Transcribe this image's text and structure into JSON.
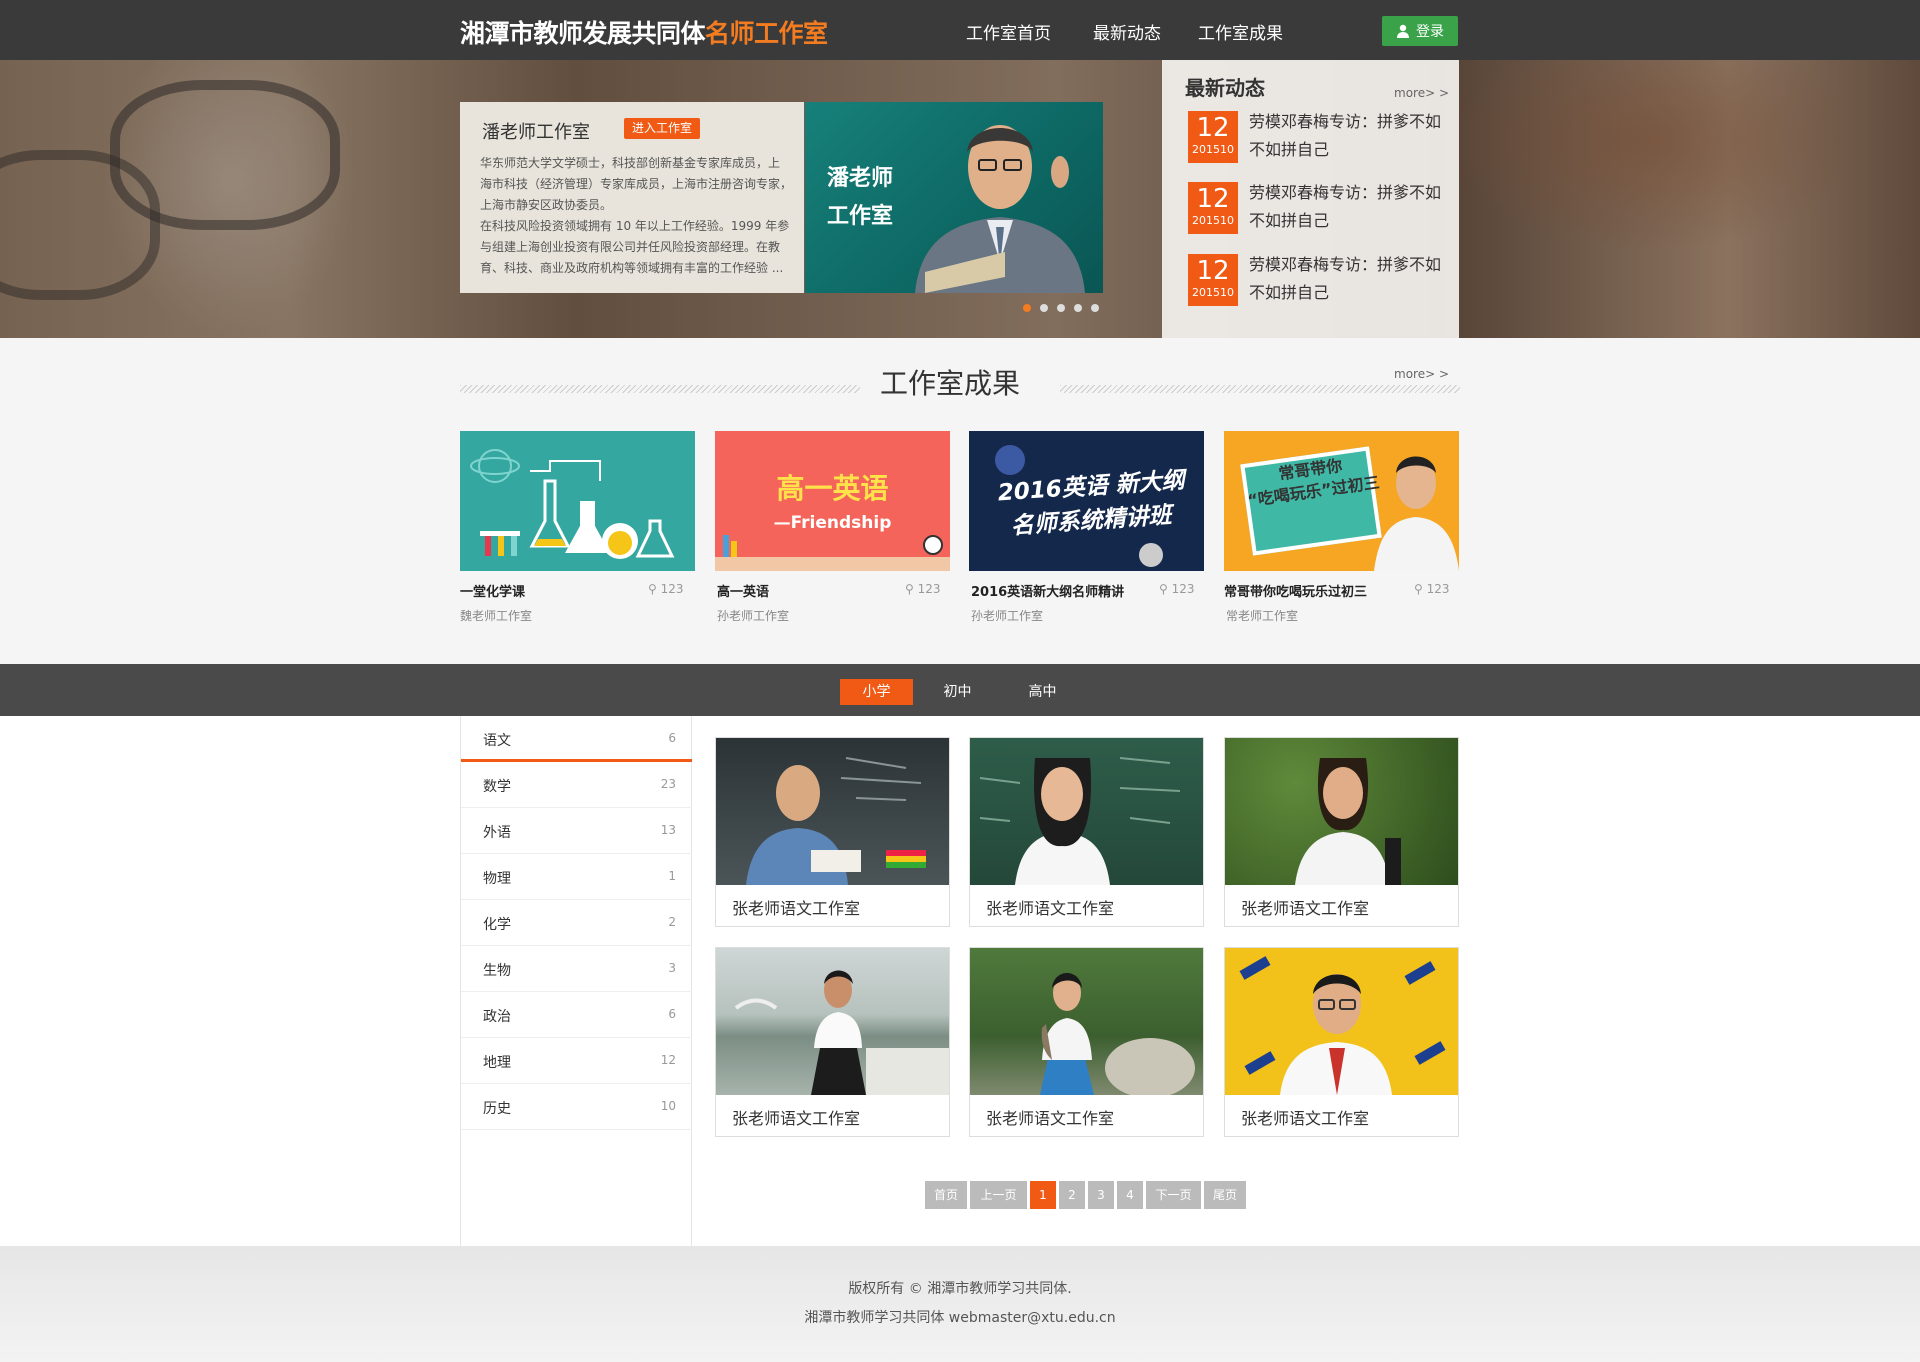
{
  "header": {
    "title_main": "湘潭市教师发展共同体",
    "title_highlight": "名师工作室",
    "nav": [
      "工作室首页",
      "最新动态",
      "工作室成果"
    ],
    "login_label": "登录"
  },
  "featured": {
    "name": "潘老师工作室",
    "badge": "进入工作室",
    "bio": [
      "华东师范大学文学硕士，科技部创新基金专家库成员，上",
      "海市科技（经济管理）专家库成员，上海市注册咨询专家，",
      "上海市静安区政协委员。",
      "在科技风险投资领域拥有 10 年以上工作经验。1999 年参",
      "与组建上海创业投资有限公司并任风险投资部经理。在教",
      "育、科技、商业及政府机构等领域拥有丰富的工作经验 ..."
    ],
    "photo_title_1": "潘老师",
    "photo_title_2": "工作室",
    "carousel_total": 5,
    "carousel_active": 1
  },
  "news": {
    "title": "最新动态",
    "more": "more> >",
    "items": [
      {
        "day": "12",
        "month": "201510",
        "text": "劳模邓春梅专访：拼爹不如不如拼自己"
      },
      {
        "day": "12",
        "month": "201510",
        "text": "劳模邓春梅专访：拼爹不如不如拼自己"
      },
      {
        "day": "12",
        "month": "201510",
        "text": "劳模邓春梅专访：拼爹不如不如拼自己"
      }
    ]
  },
  "achievements": {
    "title": "工作室成果",
    "more": "more> >",
    "cards": [
      {
        "title": "一堂化学课",
        "studio": "魏老师工作室",
        "count": "123",
        "banner": ""
      },
      {
        "title": "高一英语",
        "studio": "孙老师工作室",
        "count": "123",
        "banner": "高一英语",
        "banner_sub": "—Friendship"
      },
      {
        "title": "2016英语新大纲名师精讲",
        "studio": "孙老师工作室",
        "count": "123",
        "banner": "2016英语  新大纲",
        "banner_sub": "名师系统精讲班"
      },
      {
        "title": "常哥带你吃喝玩乐过初三",
        "studio": "常老师工作室",
        "count": "123",
        "banner": "常哥带你",
        "banner_sub": "“吃喝玩乐”过初三"
      }
    ]
  },
  "levels": {
    "tabs": [
      "小学",
      "初中",
      "高中"
    ],
    "active": 0
  },
  "subjects": [
    {
      "label": "语文",
      "count": "6"
    },
    {
      "label": "数学",
      "count": "23"
    },
    {
      "label": "外语",
      "count": "13"
    },
    {
      "label": "物理",
      "count": "1"
    },
    {
      "label": "化学",
      "count": "2"
    },
    {
      "label": "生物",
      "count": "3"
    },
    {
      "label": "政治",
      "count": "6"
    },
    {
      "label": "地理",
      "count": "12"
    },
    {
      "label": "历史",
      "count": "10"
    }
  ],
  "teachers": [
    {
      "label": "张老师语文工作室"
    },
    {
      "label": "张老师语文工作室"
    },
    {
      "label": "张老师语文工作室"
    },
    {
      "label": "张老师语文工作室"
    },
    {
      "label": "张老师语文工作室"
    },
    {
      "label": "张老师语文工作室"
    }
  ],
  "pagination": {
    "first": "首页",
    "prev": "上一页",
    "pages": [
      "1",
      "2",
      "3",
      "4"
    ],
    "next": "下一页",
    "last": "尾页",
    "active": "1"
  },
  "footer": {
    "line1": "版权所有 © 湘潭市教师学习共同体.",
    "line2": "湘潭市教师学习共同体 webmaster@xtu.edu.cn"
  },
  "colors": {
    "accent": "#f05a14",
    "header_bg": "#3a3a3a",
    "login_green": "#3aa34a"
  }
}
